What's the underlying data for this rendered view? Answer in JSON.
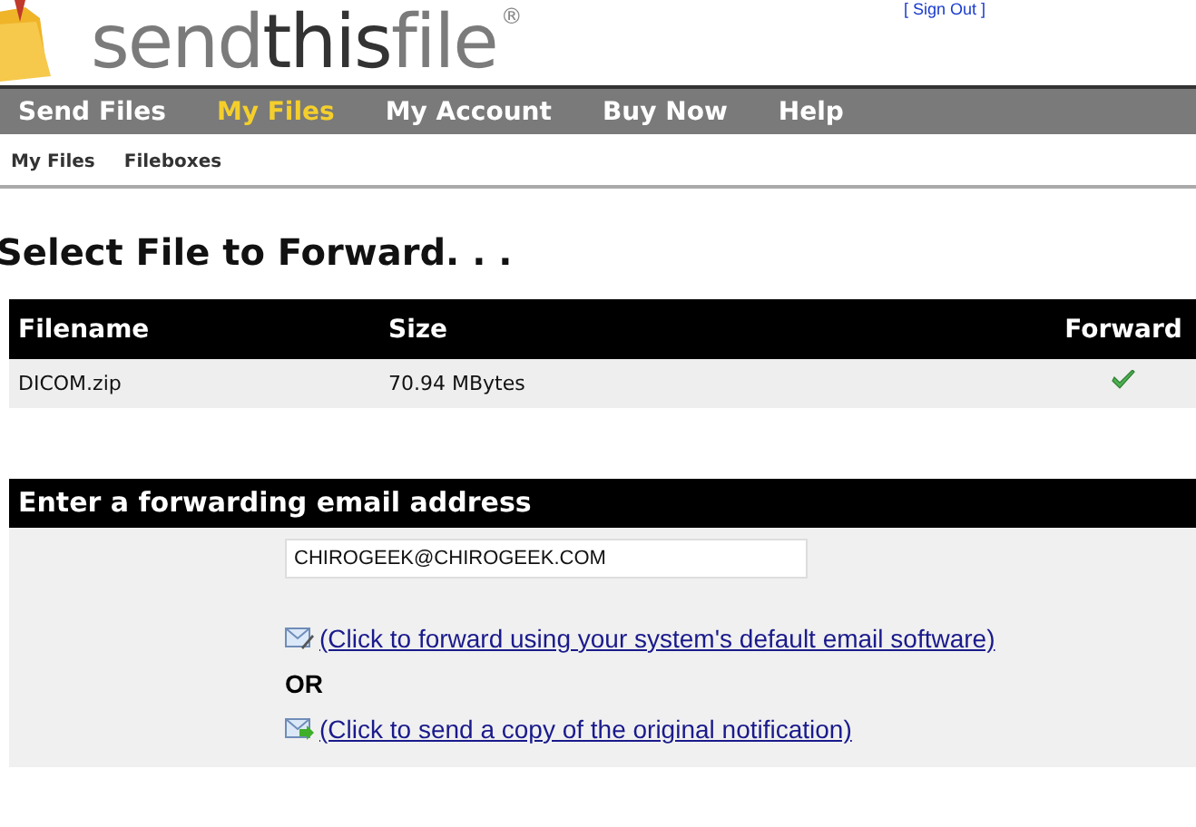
{
  "logo": {
    "parts": [
      "send",
      "this",
      "file"
    ],
    "mark": "®"
  },
  "sign_out": "[ Sign Out ]",
  "nav": [
    {
      "label": "Send Files",
      "selected": false
    },
    {
      "label": "My Files",
      "selected": true
    },
    {
      "label": "My Account",
      "selected": false
    },
    {
      "label": "Buy Now",
      "selected": false
    },
    {
      "label": "Help",
      "selected": false
    }
  ],
  "subnav": [
    "My Files",
    "Fileboxes"
  ],
  "heading": "Select File to Forward. . .",
  "table": {
    "columns": [
      "Filename",
      "Size",
      "Forward"
    ],
    "rows": [
      {
        "filename": "DICOM.zip",
        "size": "70.94 MBytes",
        "forward": true
      }
    ]
  },
  "forward_section": {
    "title": "Enter a forwarding email address",
    "email": "CHIROGEEK@CHIROGEEK.COM",
    "links": [
      {
        "kind": "software",
        "label": "(Click to forward using your system's default email software)"
      },
      {
        "kind": "notification",
        "label": "(Click to send a copy of the original notification)"
      }
    ],
    "or": "OR"
  }
}
